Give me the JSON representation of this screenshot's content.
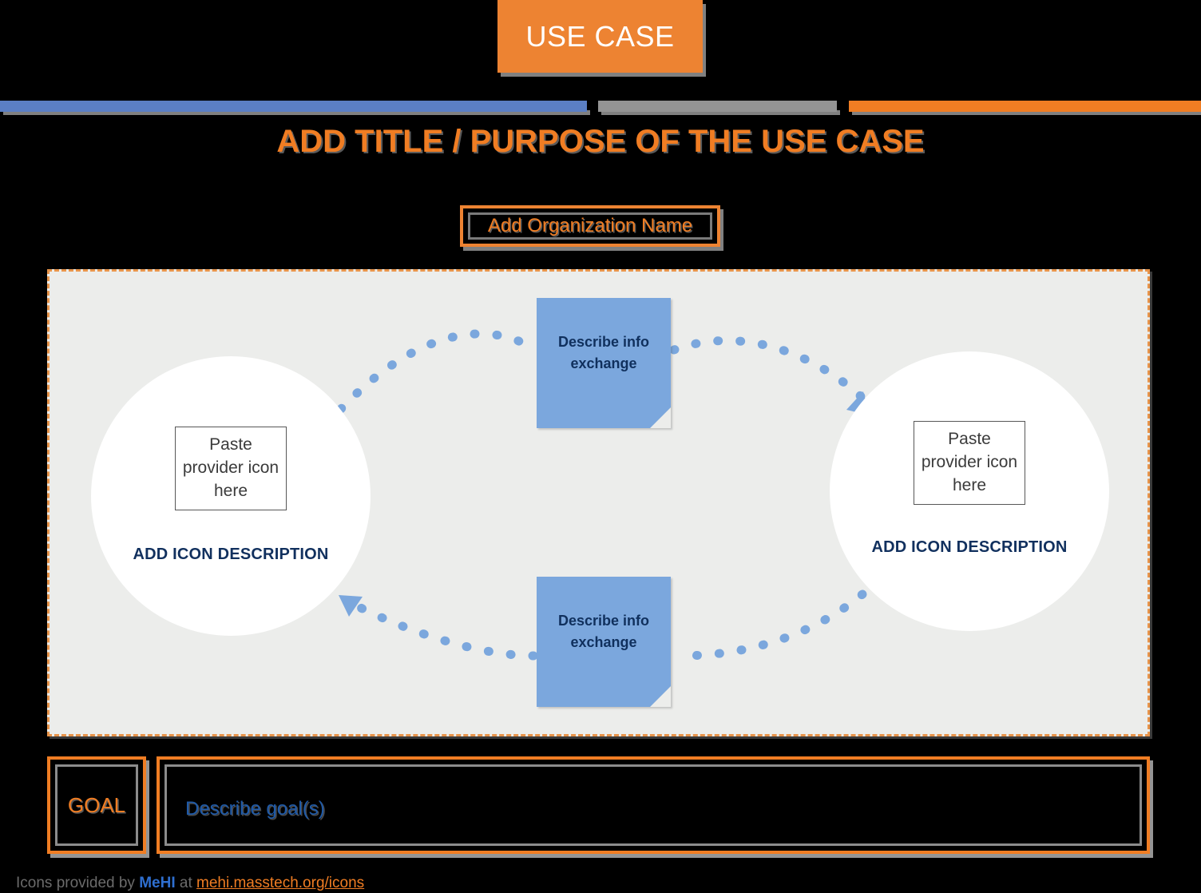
{
  "banner": {
    "label": "USE CASE",
    "background_color": "#ed8332",
    "text_color": "#ffffff"
  },
  "divider": {
    "segments": [
      {
        "name": "blue",
        "color": "#5b7fc4"
      },
      {
        "name": "gray",
        "color": "#949494"
      },
      {
        "name": "orange",
        "color": "#f07d23"
      }
    ]
  },
  "title": {
    "text": "ADD TITLE / PURPOSE OF THE USE CASE",
    "color": "#f07d23"
  },
  "organization": {
    "name": "Add Organization Name",
    "color": "#f07d23",
    "border_color": "#ed8332"
  },
  "diagram": {
    "background_color": "#ecedeb",
    "border_color": "#e8944a",
    "actors": [
      {
        "side": "left",
        "icon_placeholder": "Paste provider icon here",
        "description": "ADD ICON DESCRIPTION",
        "description_color": "#11305e"
      },
      {
        "side": "right",
        "icon_placeholder": "Paste provider icon here",
        "description": "ADD ICON DESCRIPTION",
        "description_color": "#11305e"
      }
    ],
    "notes": [
      {
        "position": "top",
        "text": "Describe info exchange",
        "fill_color": "#7ba7dd",
        "text_color": "#10305d",
        "flow_direction": "left-to-right"
      },
      {
        "position": "bottom",
        "text": "Describe info exchange",
        "fill_color": "#7ba7dd",
        "text_color": "#10305d",
        "flow_direction": "right-to-left"
      }
    ],
    "connector_color": "#7ba7dd",
    "connector_style": "dotted"
  },
  "goal": {
    "label": "GOAL",
    "label_color": "#f07d23",
    "description": "Describe goal(s)",
    "description_color": "#1f5aa8"
  },
  "footer": {
    "prefix": "Icons provided by ",
    "brand": "MeHI",
    "middle": " at ",
    "link": "mehi.masstech.org/icons"
  }
}
